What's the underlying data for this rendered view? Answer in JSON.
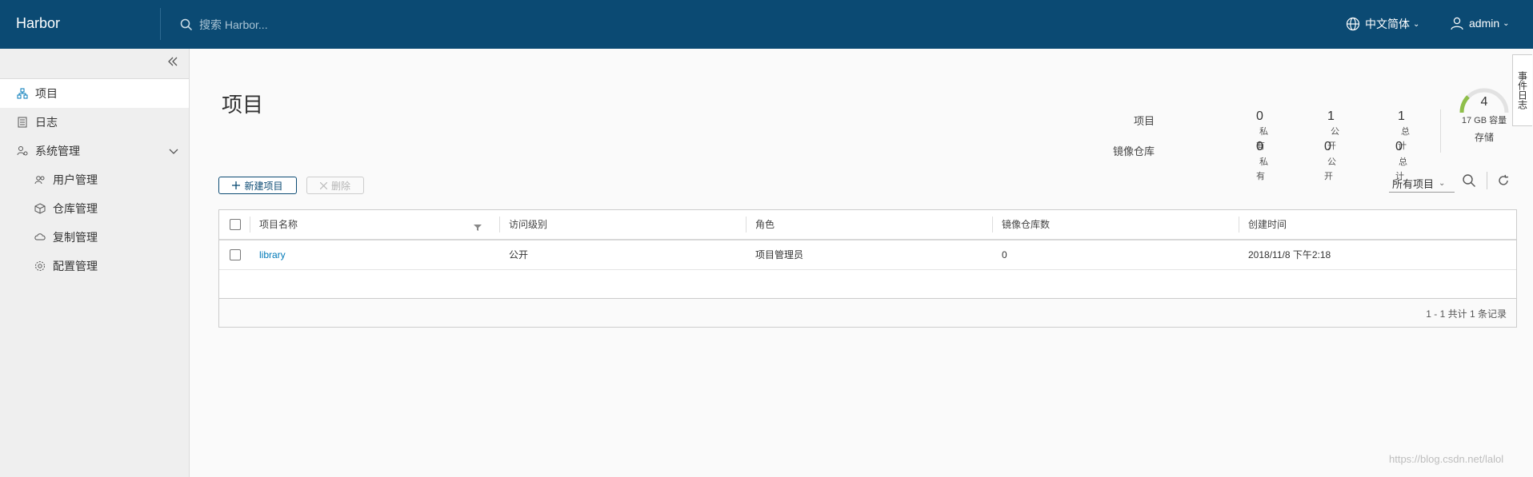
{
  "header": {
    "brand": "Harbor",
    "search_placeholder": "搜索 Harbor...",
    "language": "中文简体",
    "user": "admin"
  },
  "sidebar": {
    "items": [
      {
        "label": "项目",
        "icon": "projects-icon",
        "active": true
      },
      {
        "label": "日志",
        "icon": "logs-icon"
      },
      {
        "label": "系统管理",
        "icon": "admin-icon",
        "expandable": true
      },
      {
        "label": "用户管理",
        "icon": "users-icon"
      },
      {
        "label": "仓库管理",
        "icon": "registries-icon"
      },
      {
        "label": "复制管理",
        "icon": "replication-icon"
      },
      {
        "label": "配置管理",
        "icon": "config-icon"
      }
    ]
  },
  "main": {
    "title": "项目",
    "stats": {
      "projects_label": "项目",
      "repos_label": "镜像仓库",
      "private_unit": "私有",
      "public_unit": "公开",
      "total_unit": "总计",
      "projects": {
        "private": "0",
        "public": "1",
        "total": "1"
      },
      "repos": {
        "private": "0",
        "public": "0",
        "total": "0"
      }
    },
    "storage": {
      "count": "4",
      "capacity": "17 GB 容量",
      "label": "存储"
    },
    "event_tab": "事件日志",
    "toolbar": {
      "new_label": "新建项目",
      "delete_label": "删除",
      "filter_value": "所有项目"
    },
    "table": {
      "columns": [
        "项目名称",
        "访问级别",
        "角色",
        "镜像仓库数",
        "创建时间"
      ],
      "rows": [
        {
          "name": "library",
          "access": "公开",
          "role": "项目管理员",
          "repo_count": "0",
          "created": "2018/11/8 下午2:18"
        }
      ],
      "footer": "1 - 1 共计 1 条记录"
    }
  },
  "watermark": "https://blog.csdn.net/lalol",
  "colors": {
    "header_bg": "#0b4a73",
    "link": "#0079b8",
    "gauge_fill": "#8fbf4a"
  }
}
